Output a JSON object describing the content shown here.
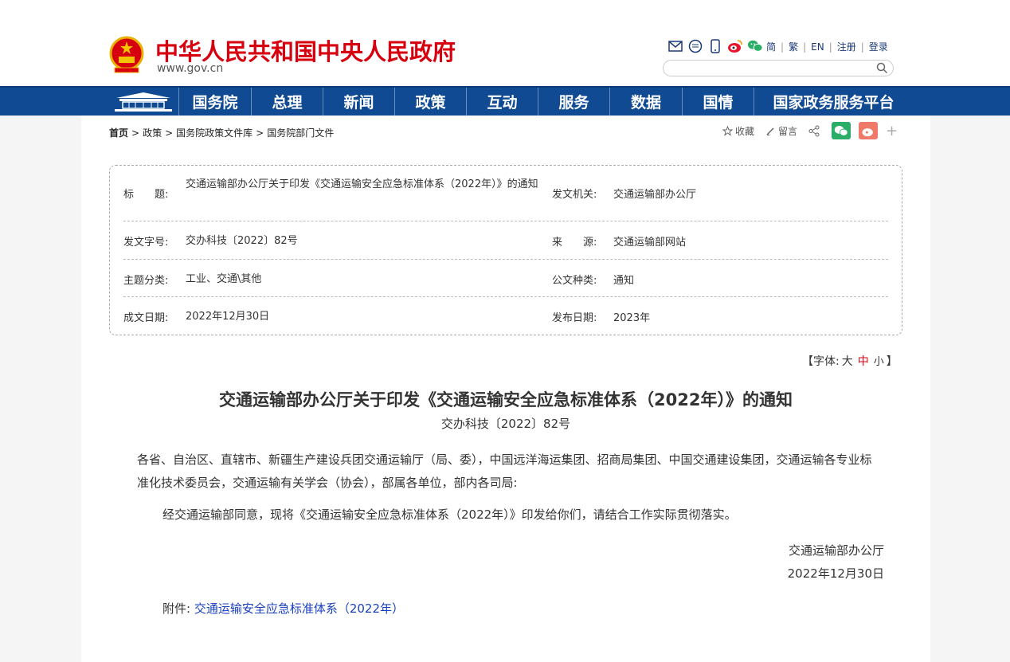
{
  "header": {
    "site_title": "中华人民共和国中央人民政府",
    "site_url": "www.gov.cn",
    "icons": [
      "mail-icon",
      "chat-icon",
      "mobile-icon",
      "weibo-icon",
      "wechat-icon"
    ],
    "lang_links": [
      "简",
      "繁",
      "EN",
      "注册",
      "登录"
    ],
    "search_placeholder": ""
  },
  "nav": {
    "items": [
      "国务院",
      "总理",
      "新闻",
      "政策",
      "互动",
      "服务",
      "数据",
      "国情",
      "国家政务服务平台"
    ]
  },
  "breadcrumb": {
    "items": [
      "首页",
      "政策",
      "国务院政策文件库",
      "国务院部门文件"
    ]
  },
  "tools": {
    "favorite": "收藏",
    "comment": "留言"
  },
  "info": {
    "title_label": "标　　题:",
    "title_value": "交通运输部办公厅关于印发《交通运输安全应急标准体系（2022年）》的通知",
    "issuer_label": "发文机关:",
    "issuer_value": "交通运输部办公厅",
    "docno_label": "发文字号:",
    "docno_value": "交办科技〔2022〕82号",
    "source_label": "来　　源:",
    "source_value": "交通运输部网站",
    "topic_label": "主题分类:",
    "topic_value": "工业、交通\\其他",
    "type_label": "公文种类:",
    "type_value": "通知",
    "created_label": "成文日期:",
    "created_value": "2022年12月30日",
    "published_label": "发布日期:",
    "published_value": "2023年"
  },
  "font_size": {
    "prefix": "【字体:",
    "large": "大",
    "medium": "中",
    "small": "小",
    "suffix": "】"
  },
  "doc": {
    "title": "交通运输部办公厅关于印发《交通运输安全应急标准体系（2022年）》的通知",
    "number": "交办科技〔2022〕82号",
    "para1": "各省、自治区、直辖市、新疆生产建设兵团交通运输厅（局、委），中国远洋海运集团、招商局集团、中国交通建设集团，交通运输各专业标准化技术委员会，交通运输有关学会（协会），部属各单位，部内各司局:",
    "para2": "经交通运输部同意，现将《交通运输安全应急标准体系（2022年）》印发给你们，请结合工作实际贯彻落实。",
    "signer": "交通运输部办公厅",
    "date": "2022年12月30日",
    "attach_label": "附件:",
    "attach_link": "交通运输安全应急标准体系（2022年）"
  },
  "colors": {
    "brand_red": "#d7000f",
    "nav_blue": "#0f4a93",
    "link_blue": "#1a3fbf"
  }
}
